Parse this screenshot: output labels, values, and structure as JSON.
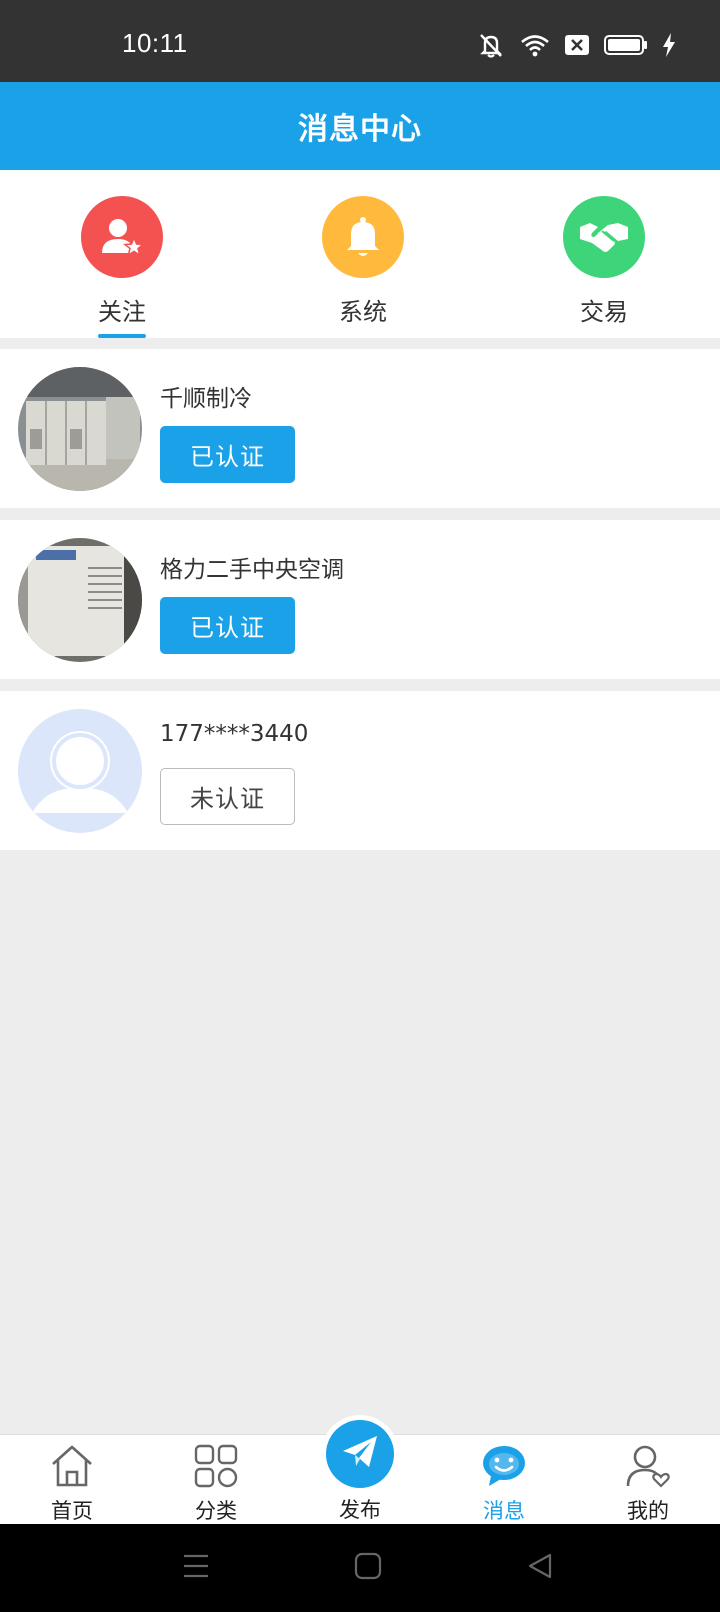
{
  "status_bar": {
    "time": "10:11",
    "icons": [
      "mute-icon",
      "wifi-icon",
      "sim-off-icon",
      "battery-icon",
      "charging-icon"
    ]
  },
  "header": {
    "title": "消息中心"
  },
  "categories": [
    {
      "label": "关注",
      "icon": "follow-star-icon",
      "color": "#f45151",
      "active": true
    },
    {
      "label": "系统",
      "icon": "bell-icon",
      "color": "#ffb93c",
      "active": false
    },
    {
      "label": "交易",
      "icon": "handshake-icon",
      "color": "#3ed47a",
      "active": false
    }
  ],
  "messages": [
    {
      "name": "千顺制冷",
      "badge": "已认证",
      "verified": true,
      "avatar": "equipment-photo"
    },
    {
      "name": "格力二手中央空调",
      "badge": "已认证",
      "verified": true,
      "avatar": "ac-unit-photo"
    },
    {
      "name": "177****3440",
      "badge": "未认证",
      "verified": false,
      "avatar": "default-user-icon"
    }
  ],
  "bottom_nav": {
    "items": [
      {
        "label": "首页",
        "icon": "home-icon"
      },
      {
        "label": "分类",
        "icon": "grid-icon"
      },
      {
        "label": "发布",
        "icon": "paper-plane-icon"
      },
      {
        "label": "消息",
        "icon": "chat-face-icon",
        "active": true
      },
      {
        "label": "我的",
        "icon": "user-heart-icon"
      }
    ]
  },
  "colors": {
    "primary": "#1ba1e8",
    "follow": "#f45151",
    "system": "#ffb93c",
    "trade": "#3ed47a",
    "background": "#ededed"
  }
}
